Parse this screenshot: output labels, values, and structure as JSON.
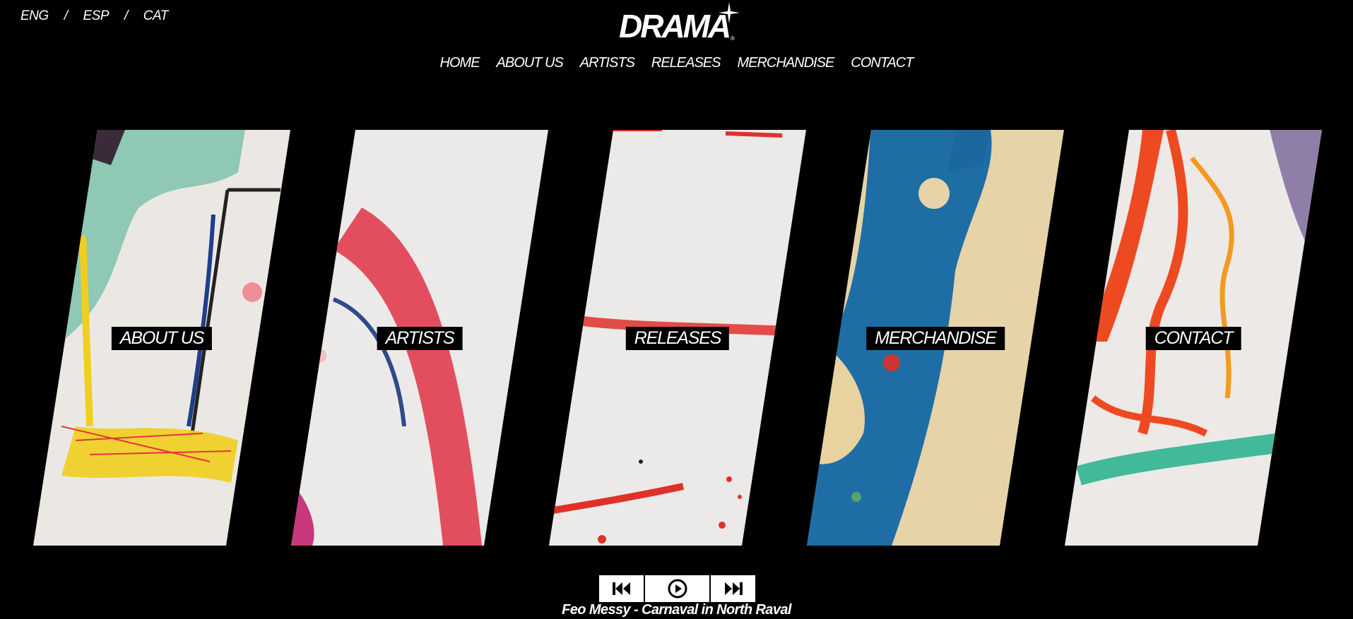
{
  "languages": [
    {
      "label": "ENG"
    },
    {
      "label": "ESP"
    },
    {
      "label": "CAT"
    }
  ],
  "language_separator": "/",
  "brand": {
    "name": "DRAMA",
    "reg_mark": "®"
  },
  "nav": [
    {
      "label": "HOME"
    },
    {
      "label": "ABOUT US"
    },
    {
      "label": "ARTISTS"
    },
    {
      "label": "RELEASES"
    },
    {
      "label": "MERCHANDISE"
    },
    {
      "label": "CONTACT"
    }
  ],
  "panels": [
    {
      "label": "ABOUT US"
    },
    {
      "label": "ARTISTS"
    },
    {
      "label": "RELEASES"
    },
    {
      "label": "MERCHANDISE"
    },
    {
      "label": "CONTACT"
    }
  ],
  "player": {
    "icons": [
      "skip-previous-icon",
      "play-icon",
      "skip-next-icon"
    ],
    "now_playing": "Feo Messy - Carnaval in North Raval"
  },
  "colors": {
    "background": "#000000",
    "text": "#ffffff",
    "paper": "#ece9e6"
  }
}
